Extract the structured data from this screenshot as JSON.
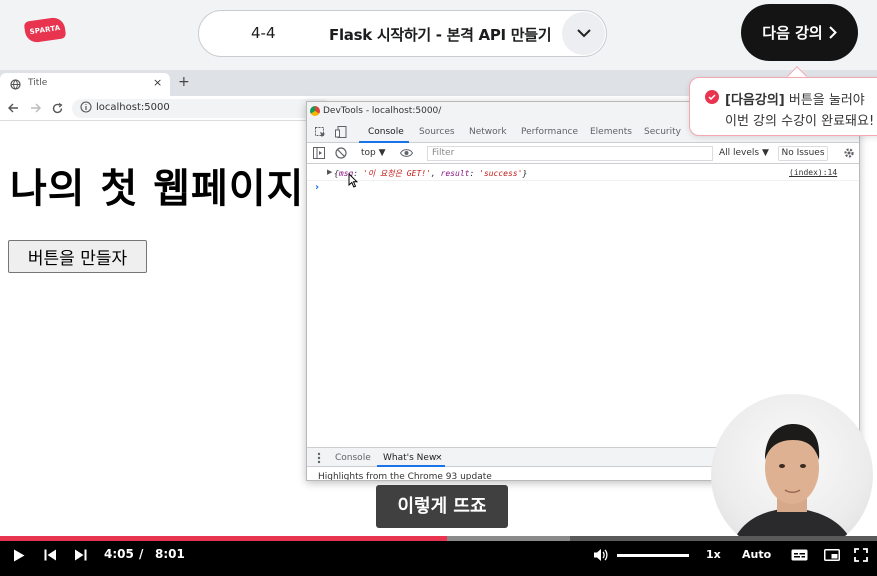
{
  "course": {
    "logo_text": "SPARTA",
    "lesson_number": "4-4",
    "lesson_title": "Flask 시작하기 - 본격 API 만들기",
    "next_lesson_label": "다음 강의",
    "accent_color": "#e8344e"
  },
  "toast": {
    "highlight": "[다음강의]",
    "line1_rest": " 버튼을 눌러야",
    "line2": "이번 강의 수강이 완료돼요!"
  },
  "browser": {
    "tab_title": "Title",
    "tab_close": "×",
    "new_tab": "+",
    "url": "localhost:5000"
  },
  "page": {
    "heading": "나의 첫 웹페이지",
    "button_label": "버튼을 만들자"
  },
  "devtools": {
    "window_title": "DevTools - localhost:5000/",
    "tabs": [
      "Console",
      "Sources",
      "Network",
      "Performance",
      "Elements",
      "Security"
    ],
    "active_tab": "Console",
    "context": "top ▼",
    "filter_placeholder": "Filter",
    "levels": "All levels ▼",
    "issues": "No Issues",
    "console_line": {
      "open": "{",
      "key1": "msg",
      "sep1": ": ",
      "val1": "'이 요청은 GET!'",
      "sep2": ", ",
      "key2": "result",
      "sep3": ": ",
      "val2": "'success'",
      "close": "}",
      "source": "(index):14"
    },
    "prompt": "›",
    "drawer_tabs": [
      "Console",
      "What's New"
    ],
    "drawer_close": "×",
    "drawer_text": "Highlights from the Chrome 93 update"
  },
  "subtitle": "이렇게 뜨죠",
  "player": {
    "current_time": "4:05",
    "separator": "/",
    "duration": "8:01",
    "progress": 0.51,
    "buffered": 0.65,
    "speed": "1x",
    "quality": "Auto"
  }
}
